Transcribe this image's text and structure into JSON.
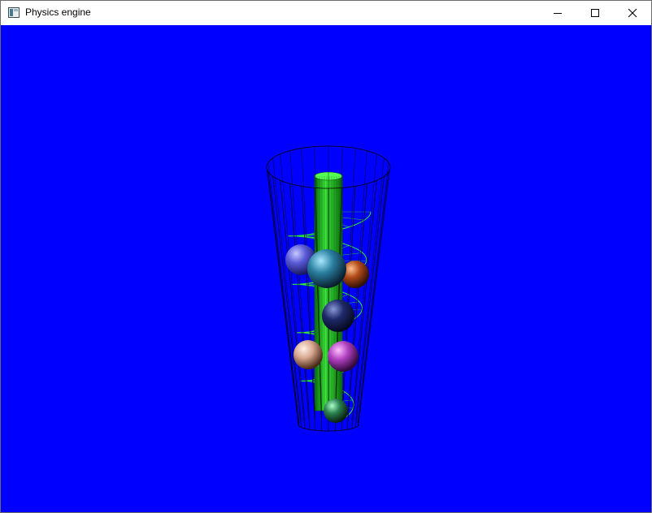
{
  "window": {
    "title": "Physics engine",
    "app_icon": "window-app-icon",
    "controls": [
      {
        "name": "minimize-button",
        "icon": "minimize-icon"
      },
      {
        "name": "maximize-button",
        "icon": "maximize-icon"
      },
      {
        "name": "close-button",
        "icon": "close-icon"
      }
    ]
  },
  "viewport": {
    "background_color": "#0000ff",
    "scene": {
      "container": "wireframe-cylinder",
      "container_color": "#000000",
      "center_pole_color": "#22cc22",
      "spiral_ramp_color": "#33dd33",
      "balls": [
        {
          "name": "ball-blue-left",
          "color": "#5a5ad8"
        },
        {
          "name": "ball-teal",
          "color": "#2a7fa0"
        },
        {
          "name": "ball-orange",
          "color": "#b04a18"
        },
        {
          "name": "ball-navy",
          "color": "#1e2a6a"
        },
        {
          "name": "ball-peach",
          "color": "#d8a890"
        },
        {
          "name": "ball-magenta",
          "color": "#b040c0"
        },
        {
          "name": "ball-green",
          "color": "#2a8050"
        }
      ]
    }
  }
}
